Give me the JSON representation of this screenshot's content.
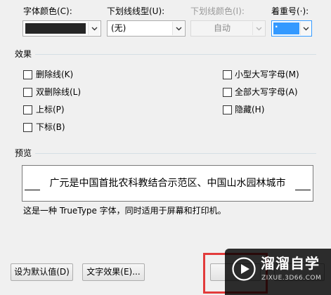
{
  "font_color": {
    "label": "字体颜色(C):",
    "swatch_color": "#262626"
  },
  "underline_style": {
    "label": "下划线线型(U):",
    "value": "(无)"
  },
  "underline_color": {
    "label": "下划线颜色(I):",
    "value": "自动"
  },
  "emphasis_mark": {
    "label": "着重号(·):",
    "value": "·"
  },
  "effects": {
    "title": "效果",
    "items": [
      {
        "label": "删除线(K)"
      },
      {
        "label": "双删除线(L)"
      },
      {
        "label": "上标(P)"
      },
      {
        "label": "下标(B)"
      },
      {
        "label": "小型大写字母(M)"
      },
      {
        "label": "全部大写字母(A)"
      },
      {
        "label": "隐藏(H)"
      }
    ]
  },
  "preview": {
    "title": "预览",
    "sample": "广元是中国首批农科教结合示范区、中国山水园林城市",
    "note": "这是一种 TrueType 字体，同时适用于屏幕和打印机。"
  },
  "buttons": {
    "set_default": "设为默认值(D)",
    "text_effects": "文字效果(E)..."
  },
  "watermark": {
    "brand": "溜溜自学",
    "site": "ZIXUE.3D66.COM"
  },
  "colors": {
    "accent": "#3399ff",
    "highlight_border": "#e23b3b"
  }
}
